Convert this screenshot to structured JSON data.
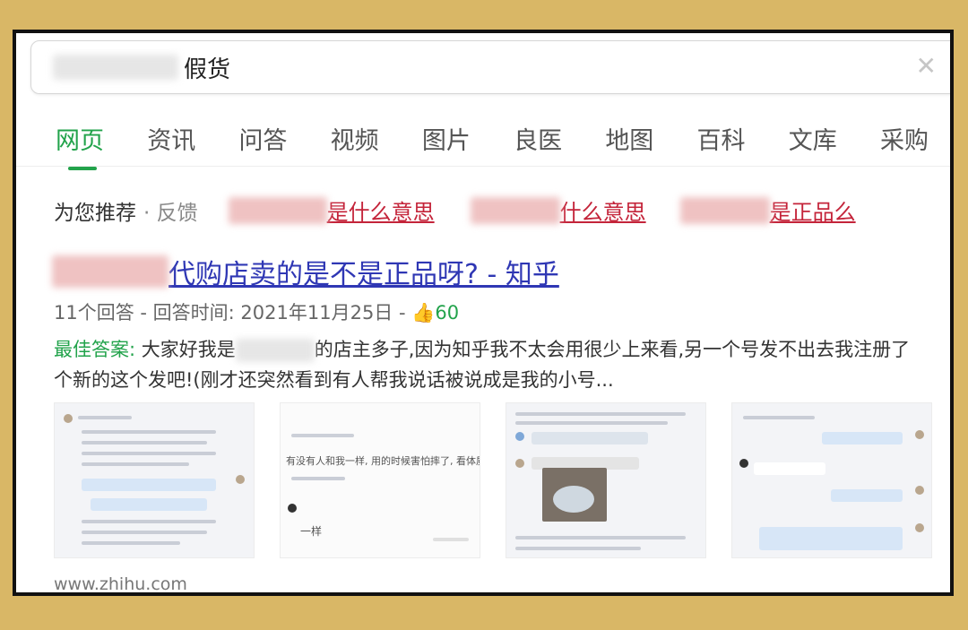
{
  "search": {
    "query_visible": "假货"
  },
  "tabs": [
    "网页",
    "资讯",
    "问答",
    "视频",
    "图片",
    "良医",
    "地图",
    "百科",
    "文库",
    "采购"
  ],
  "recommend": {
    "label": "为您推荐",
    "feedback": "· 反馈",
    "links": [
      "是什么意思",
      "什么意思",
      "是正品么"
    ]
  },
  "result": {
    "title": "代购店卖的是不是正品呀? - 知乎",
    "answers": "11个回答",
    "sep1": " - ",
    "time_label": "回答时间: 2021年11月25日",
    "sep2": " - ",
    "likes": "60",
    "best_label": "最佳答案:",
    "best_pre": " 大家好我是",
    "best_post": "的店主多子,因为知乎我不太会用很少上来看,另一个号发不出去我注册了个新的这个发吧!(刚才还突然看到有人帮我说话被说成是我的小号...",
    "thumb2_caption1": "有没有人和我一样, 用的时候害怕摔了, 看体质",
    "thumb2_caption2": "一样",
    "url": "www.zhihu.com"
  },
  "colors": {
    "accent_green": "#22a34b",
    "link_blue": "#2f37b4",
    "link_red": "#c4243a",
    "border_gold": "#d9b766"
  }
}
